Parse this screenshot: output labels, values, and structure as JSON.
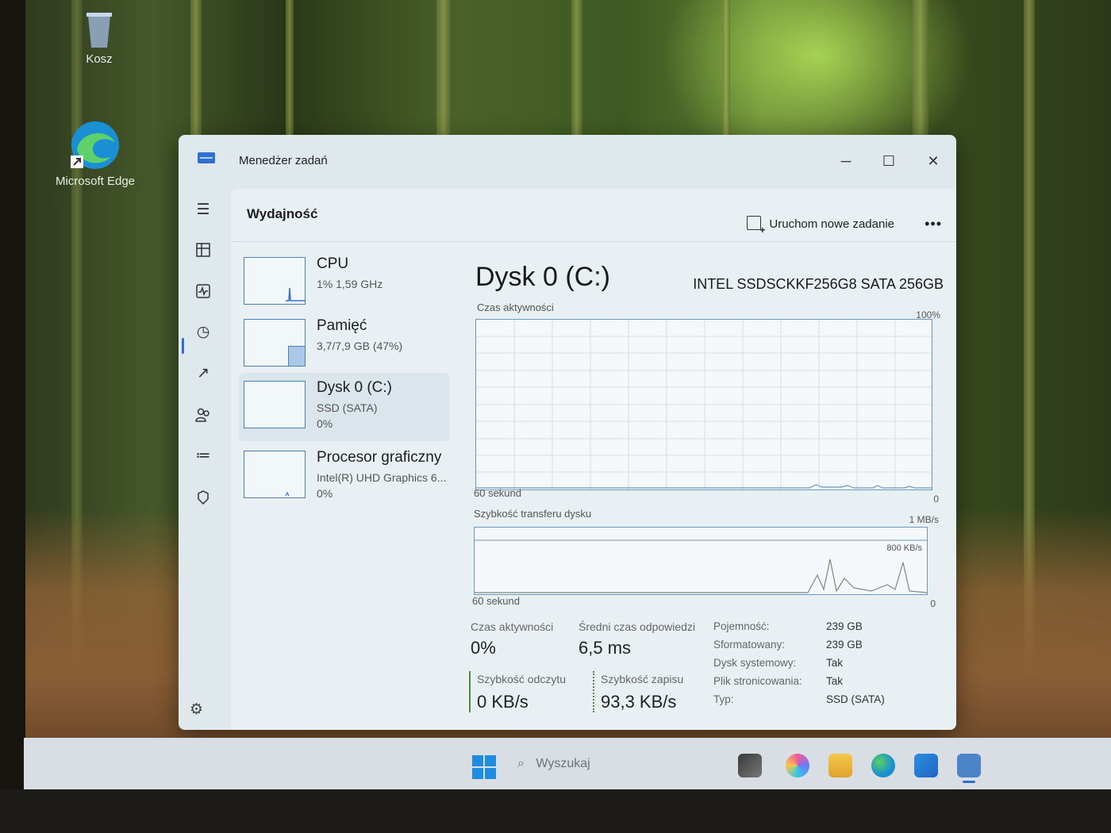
{
  "desktop": {
    "icons": [
      {
        "label": "Kosz",
        "icon": "recycle-bin-icon"
      },
      {
        "label": "Microsoft Edge",
        "icon": "edge-icon"
      }
    ]
  },
  "window": {
    "title": "Menedżer zadań",
    "controls": {
      "minimize": "─",
      "maximize": "☐",
      "close": "✕"
    }
  },
  "nav": {
    "items": [
      "menu-icon",
      "processes-icon",
      "performance-icon",
      "app-history-icon",
      "startup-icon",
      "users-icon",
      "details-icon",
      "services-icon"
    ],
    "settings": "settings-icon"
  },
  "header": {
    "title": "Wydajność",
    "run_task": "Uruchom nowe zadanie",
    "more": "•••"
  },
  "resources": [
    {
      "name": "CPU",
      "sub": "1% 1,59 GHz",
      "sub2": ""
    },
    {
      "name": "Pamięć",
      "sub": "3,7/7,9 GB (47%)",
      "sub2": ""
    },
    {
      "name": "Dysk 0 (C:)",
      "sub": "SSD (SATA)",
      "sub2": "0%"
    },
    {
      "name": "Procesor graficzny",
      "sub": "Intel(R) UHD Graphics 6...",
      "sub2": "0%"
    }
  ],
  "detail": {
    "title": "Dysk 0 (C:)",
    "model": "INTEL SSDSCKKF256G8 SATA 256GB",
    "graph1": {
      "label": "Czas aktywności",
      "max": "100%",
      "xlabel": "60 sekund",
      "min": "0"
    },
    "graph2": {
      "label": "Szybkość transferu dysku",
      "max": "1 MB/s",
      "inner": "800 KB/s",
      "xlabel": "60 sekund",
      "min": "0"
    },
    "stats": {
      "active_label": "Czas aktywności",
      "active_value": "0%",
      "response_label": "Średni czas odpowiedzi",
      "response_value": "6,5 ms",
      "read_label": "Szybkość odczytu",
      "read_value": "0 KB/s",
      "write_label": "Szybkość zapisu",
      "write_value": "93,3 KB/s"
    },
    "props": [
      {
        "label": "Pojemność:",
        "value": "239 GB"
      },
      {
        "label": "Sformatowany:",
        "value": "239 GB"
      },
      {
        "label": "Dysk systemowy:",
        "value": "Tak"
      },
      {
        "label": "Plik stronicowania:",
        "value": "Tak"
      },
      {
        "label": "Typ:",
        "value": "SSD (SATA)"
      }
    ]
  },
  "taskbar": {
    "search_placeholder": "Wyszukaj",
    "apps": [
      "widgets-icon",
      "copilot-icon",
      "file-explorer-icon",
      "edge-icon",
      "store-icon",
      "task-manager-icon"
    ]
  },
  "colors": {
    "accent": "#2f6fd0",
    "graph_line": "#6b98c2",
    "read_bar": "#4d8a3a"
  }
}
